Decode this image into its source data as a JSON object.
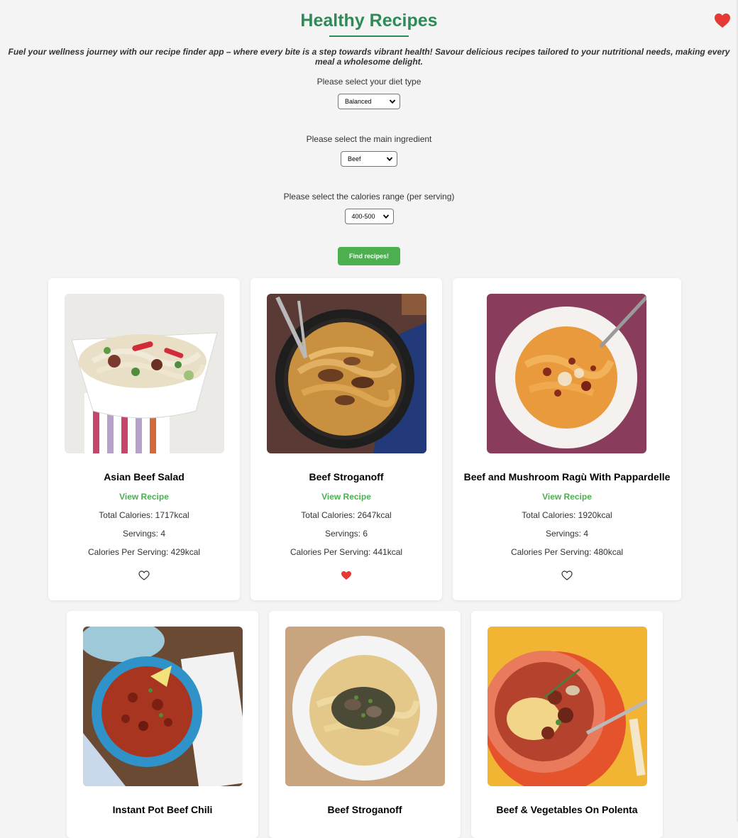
{
  "header": {
    "title": "Healthy Recipes",
    "favorites_icon": "heart-icon"
  },
  "tagline": "Fuel your wellness journey with our recipe finder app – where every bite is a step towards vibrant health! Savour delicious recipes tailored to your nutritional needs, making every meal a wholesome delight.",
  "form": {
    "diet": {
      "label": "Please select your diet type",
      "value": "Balanced"
    },
    "ingredient": {
      "label": "Please select the main ingredient",
      "value": "Beef"
    },
    "calories": {
      "label": "Please select the calories range (per serving)",
      "value": "400-500"
    },
    "submit_label": "Find recipes!"
  },
  "colors": {
    "title": "#2e8b57",
    "accent": "#4caf50",
    "favorite": "#e53935"
  },
  "recipes": [
    {
      "name": "Asian Beef Salad",
      "link": "View Recipe",
      "total_calories": "Total Calories: 1717kcal",
      "servings": "Servings: 4",
      "per_serving": "Calories Per Serving: 429kcal",
      "favorited": false
    },
    {
      "name": "Beef Stroganoff",
      "link": "View Recipe",
      "total_calories": "Total Calories: 2647kcal",
      "servings": "Servings: 6",
      "per_serving": "Calories Per Serving: 441kcal",
      "favorited": true
    },
    {
      "name": "Beef and Mushroom Ragù With Pappardelle",
      "link": "View Recipe",
      "total_calories": "Total Calories: 1920kcal",
      "servings": "Servings: 4",
      "per_serving": "Calories Per Serving: 480kcal",
      "favorited": false
    },
    {
      "name": "Instant Pot Beef Chili"
    },
    {
      "name": "Beef Stroganoff"
    },
    {
      "name": "Beef & Vegetables On Polenta"
    }
  ]
}
